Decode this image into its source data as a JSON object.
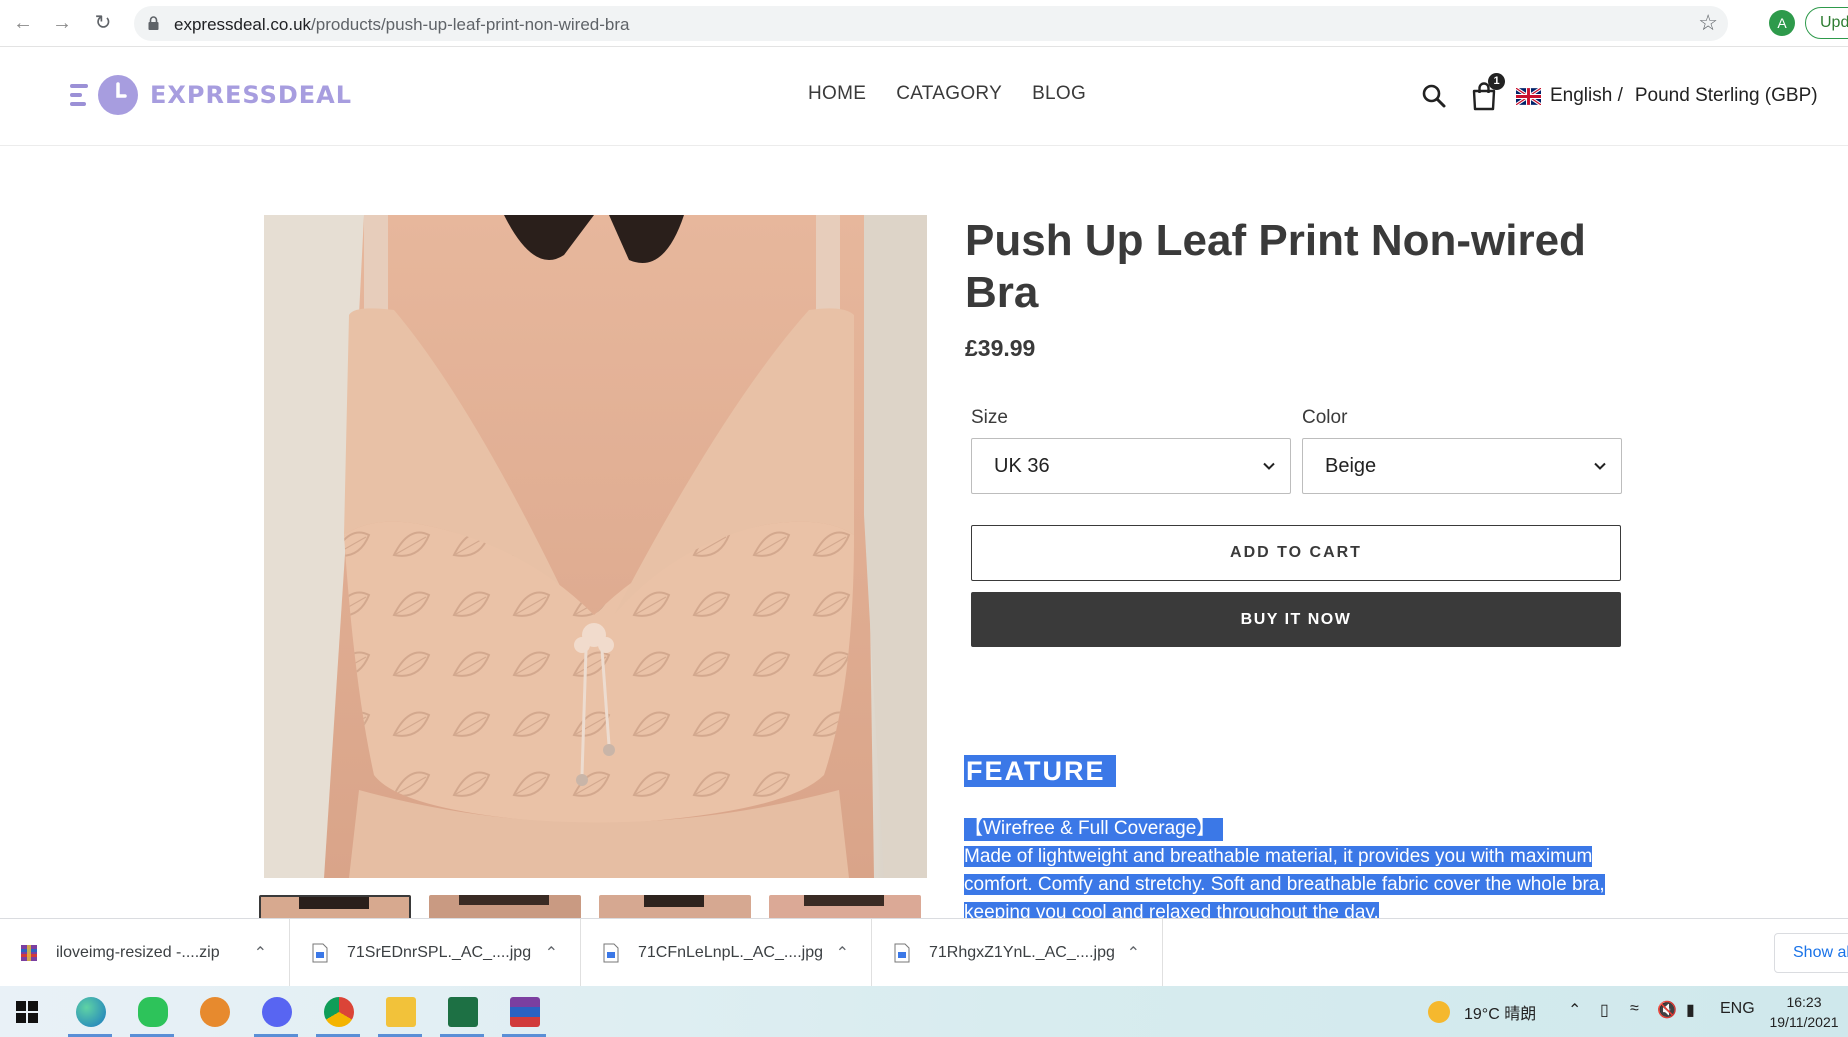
{
  "browser": {
    "url_domain": "expressdeal.co.uk",
    "url_path": "/products/push-up-leaf-print-non-wired-bra",
    "profile_initial": "A",
    "update_label": "Upd"
  },
  "header": {
    "logo_text": "EXPRESSDEAL",
    "nav": [
      "HOME",
      "CATAGORY",
      "BLOG"
    ],
    "cart_count": "1",
    "language": "English /",
    "currency": "Pound Sterling (GBP)",
    "colors": {
      "logo": "#a79ddf"
    }
  },
  "product": {
    "title": "Push Up Leaf Print Non-wired Bra",
    "price": "£39.99",
    "size_label": "Size",
    "size_value": "UK 36",
    "color_label": "Color",
    "color_value": "Beige",
    "add_to_cart": "ADD TO CART",
    "buy_now": "BUY IT NOW",
    "feature_heading": "FEATURE",
    "feature_subheading": "【Wirefree & Full Coverage】",
    "feature_line1": "Made of lightweight and breathable material, it provides you with maximum",
    "feature_line2": "comfort. Comfy and stretchy. Soft and breathable fabric cover the whole bra,",
    "feature_line3": "keeping you cool and relaxed throughout the day."
  },
  "downloads": {
    "items": [
      {
        "name": "iloveimg-resized -....zip",
        "icon": "archive-icon"
      },
      {
        "name": "71SrEDnrSPL._AC_....jpg",
        "icon": "image-file-icon"
      },
      {
        "name": "71CFnLeLnpL._AC_....jpg",
        "icon": "image-file-icon"
      },
      {
        "name": "71RhgxZ1YnL._AC_....jpg",
        "icon": "image-file-icon"
      }
    ],
    "show_all": "Show al"
  },
  "taskbar": {
    "weather": "19°C 晴朗",
    "lang": "ENG",
    "time": "16:23",
    "date": "19/11/2021"
  }
}
